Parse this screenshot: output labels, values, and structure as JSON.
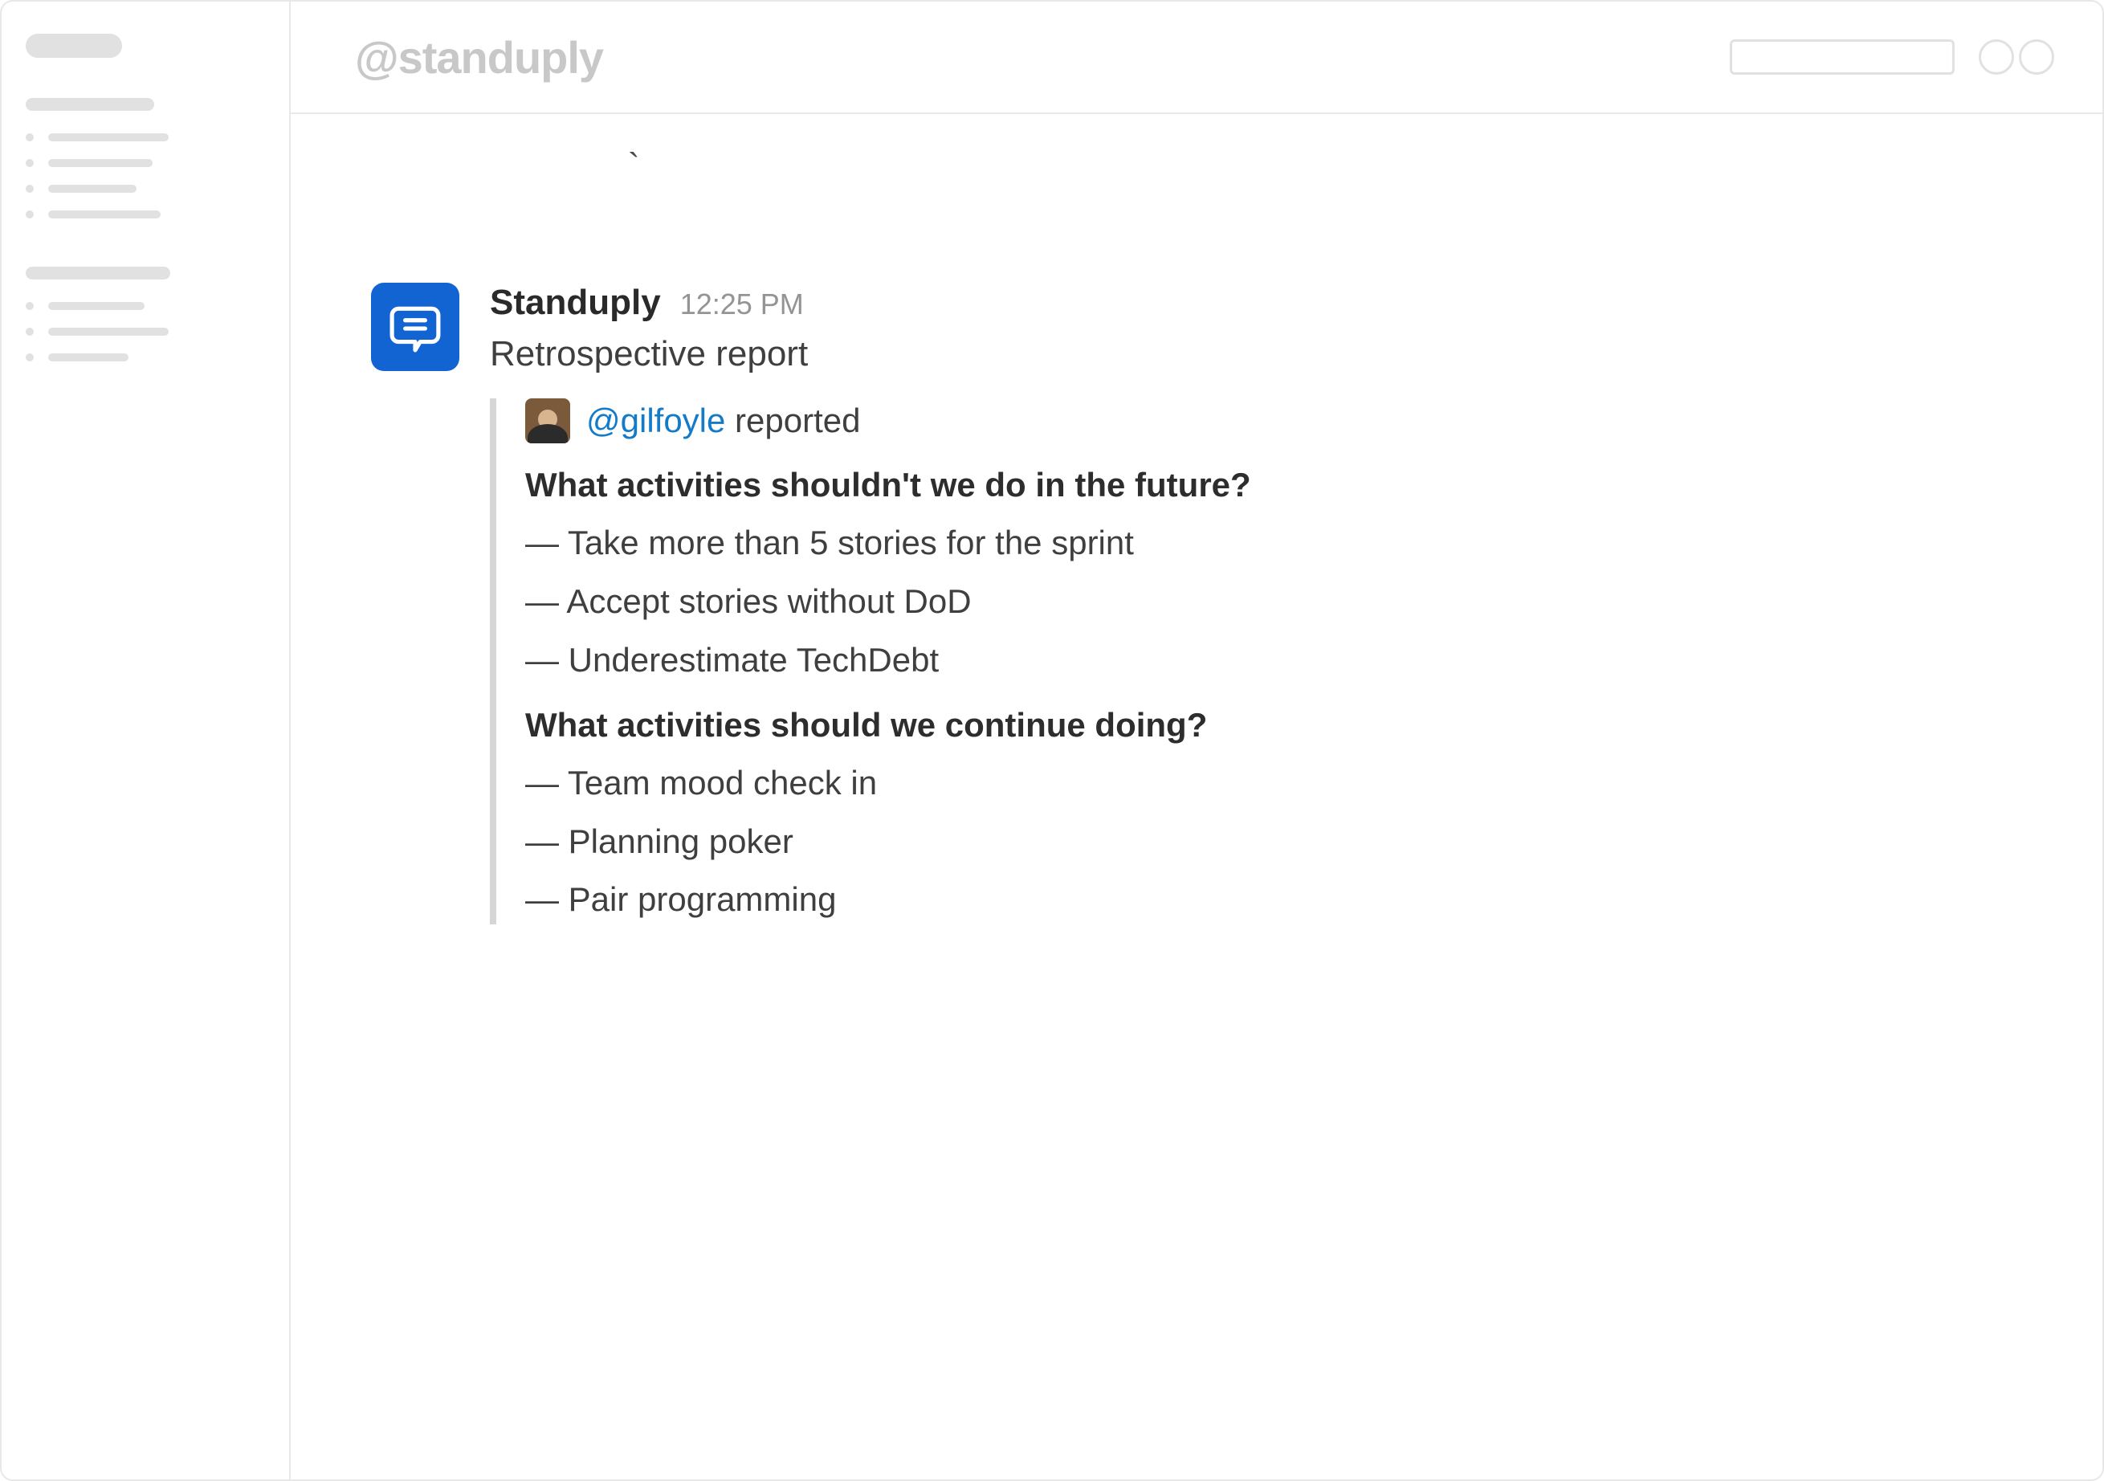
{
  "header": {
    "channel_title": "@standuply"
  },
  "message": {
    "author": "Standuply",
    "timestamp": "12:25 PM",
    "title": "Retrospective report",
    "stray_char": "`"
  },
  "attachment": {
    "reporter_mention": "@gilfoyle",
    "reported_label": " reported",
    "sections": [
      {
        "question": "What activities shouldn't we do in the future?",
        "answers": [
          "— Take more than  5 stories for the sprint",
          "— Accept stories without DoD",
          "— Underestimate TechDebt"
        ]
      },
      {
        "question": "What activities should we continue doing?",
        "answers": [
          "— Team mood check in",
          "— Planning poker",
          "— Pair programming"
        ]
      }
    ]
  },
  "colors": {
    "accent": "#1364D3",
    "link": "#147BC9"
  }
}
